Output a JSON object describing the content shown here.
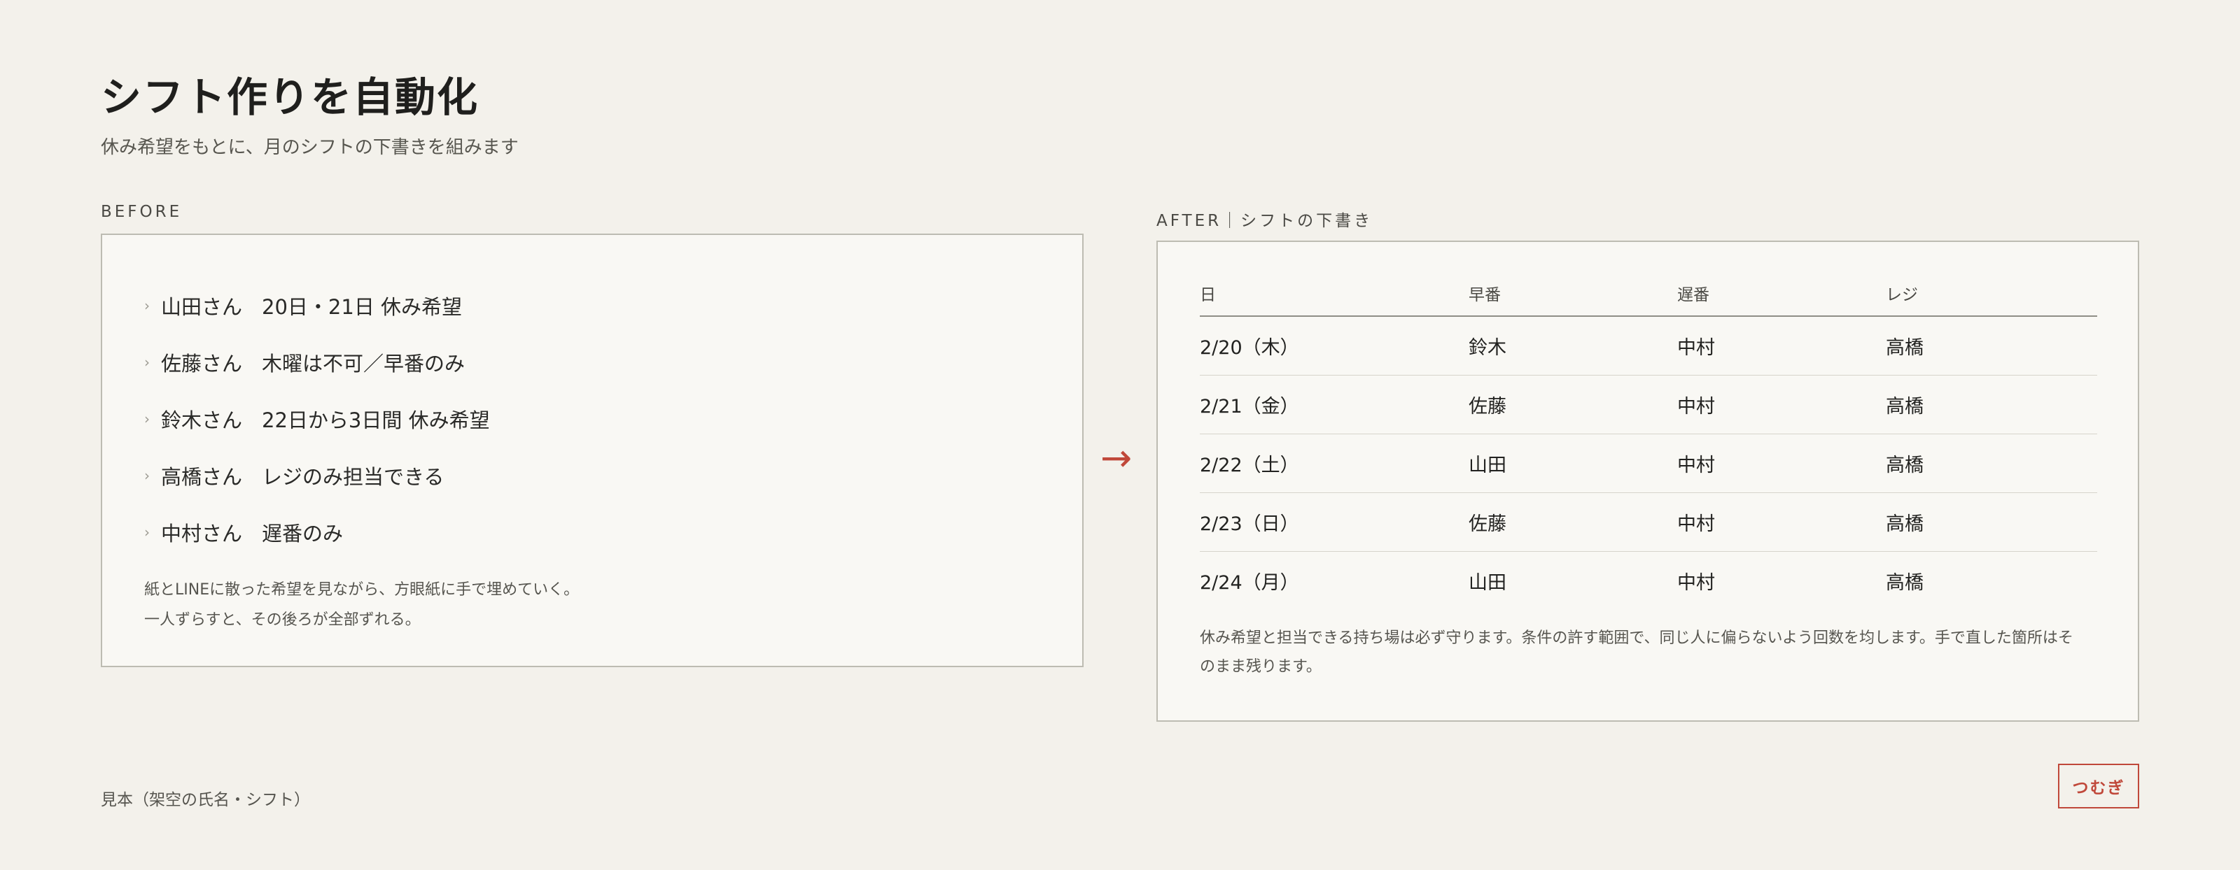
{
  "header": {
    "title": "シフト作りを自動化",
    "subtitle": "休み希望をもとに、月のシフトの下書きを組みます"
  },
  "before": {
    "label": "BEFORE",
    "chevron": "›",
    "requests": [
      {
        "name": "山田さん",
        "text": "20日・21日 休み希望"
      },
      {
        "name": "佐藤さん",
        "text": "木曜は不可／早番のみ"
      },
      {
        "name": "鈴木さん",
        "text": "22日から3日間 休み希望"
      },
      {
        "name": "高橋さん",
        "text": "レジのみ担当できる"
      },
      {
        "name": "中村さん",
        "text": "遅番のみ"
      }
    ],
    "note_lines": [
      "紙とLINEに散った希望を見ながら、方眼紙に手で埋めていく。",
      "一人ずらすと、その後ろが全部ずれる。"
    ]
  },
  "arrow": "→",
  "after": {
    "label": "AFTER｜シフトの下書き",
    "columns": [
      "日",
      "早番",
      "遅番",
      "レジ"
    ],
    "rows": [
      [
        "2/20（木）",
        "鈴木",
        "中村",
        "高橋"
      ],
      [
        "2/21（金）",
        "佐藤",
        "中村",
        "高橋"
      ],
      [
        "2/22（土）",
        "山田",
        "中村",
        "高橋"
      ],
      [
        "2/23（日）",
        "佐藤",
        "中村",
        "高橋"
      ],
      [
        "2/24（月）",
        "山田",
        "中村",
        "高橋"
      ]
    ],
    "note": "休み希望と担当できる持ち場は必ず守ります。条件の許す範囲で、同じ人に偏らないよう回数を均します。手で直した箇所はそのまま残ります。"
  },
  "footer": {
    "note": "見本（架空の氏名・シフト）",
    "brand": "つむぎ"
  },
  "colors": {
    "background": "#f3f1eb",
    "accent": "#c0483a"
  }
}
